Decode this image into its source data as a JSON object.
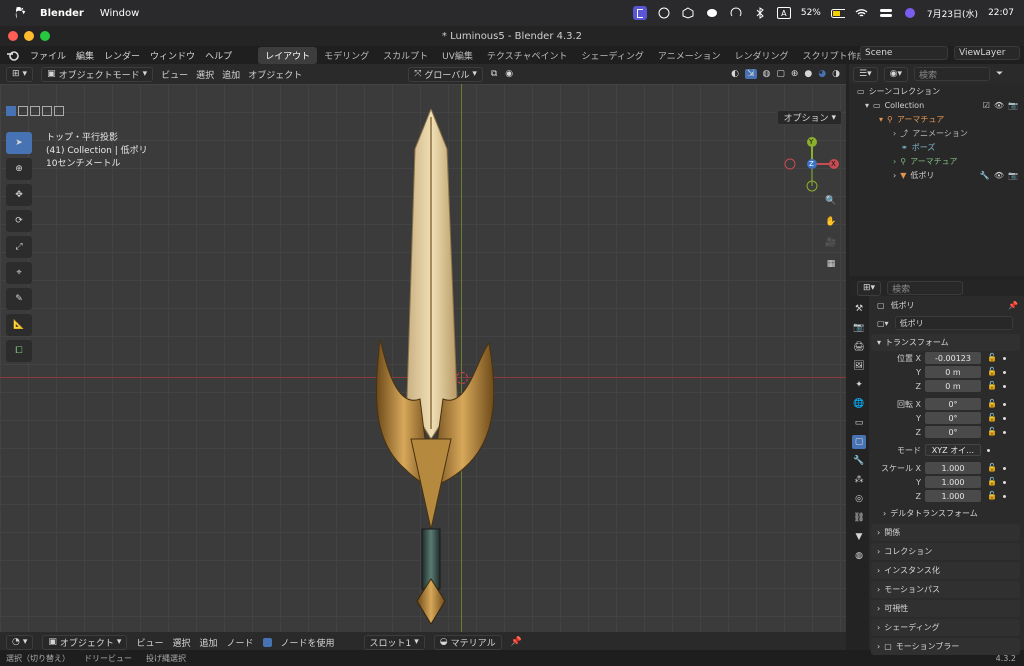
{
  "macbar": {
    "app": "Blender",
    "menu": "Window",
    "battery": "52%",
    "input": "A",
    "datetime": "7月23日(水)",
    "time": "22:07"
  },
  "window": {
    "title": "* Luminous5 - Blender 4.3.2"
  },
  "menubar": {
    "items": [
      "ファイル",
      "編集",
      "レンダー",
      "ウィンドウ",
      "ヘルプ"
    ],
    "workspaces": [
      "レイアウト",
      "モデリング",
      "スカルプト",
      "UV編集",
      "テクスチャペイント",
      "シェーディング",
      "アニメーション",
      "レンダリング",
      "スクリプト作成"
    ],
    "active_workspace": "レイアウト",
    "scene": "Scene",
    "view_layer": "ViewLayer",
    "add_tab": "+"
  },
  "viewport_header": {
    "mode": "オブジェクトモード",
    "menus": [
      "ビュー",
      "選択",
      "追加",
      "オブジェクト"
    ],
    "orientation": "グローバル",
    "options": "オプション"
  },
  "viewport_info": {
    "line1": "トップ・平行投影",
    "line2": "(41) Collection | 低ポリ",
    "line3": "10センチメートル"
  },
  "gizmo": {
    "x": "X",
    "y": "Y",
    "z": "Z"
  },
  "footer": {
    "mode": "オブジェクト",
    "menus": [
      "ビュー",
      "選択",
      "追加",
      "ノード"
    ],
    "use_nodes": "ノードを使用",
    "slot": "スロット1",
    "material": "マテリアル"
  },
  "status": {
    "items": [
      "選択（切り替え）",
      "ドリービュー",
      "投げ縄選択"
    ],
    "version": "4.3.2"
  },
  "outliner": {
    "search_placeholder": "検索",
    "rows": [
      {
        "label": "シーンコレクション",
        "indent": 0
      },
      {
        "label": "Collection",
        "indent": 1
      },
      {
        "label": "アーマチュア",
        "indent": 2
      },
      {
        "label": "アニメーション",
        "indent": 3
      },
      {
        "label": "ポーズ",
        "indent": 3
      },
      {
        "label": "アーマチュア",
        "indent": 3
      },
      {
        "label": "低ポリ",
        "indent": 3
      }
    ]
  },
  "properties": {
    "search_placeholder": "検索",
    "object_name": "低ポリ",
    "object_field": "低ポリ",
    "section_transform": "トランスフォーム",
    "location": {
      "label": "位置",
      "x": "-0.00123",
      "y": "0 m",
      "z": "0 m"
    },
    "rotation": {
      "label": "回転",
      "x": "0°",
      "y": "0°",
      "z": "0°"
    },
    "mode": {
      "label": "モード",
      "value": "XYZ オイ…"
    },
    "scale": {
      "label": "スケール",
      "x": "1.000",
      "y": "1.000",
      "z": "1.000"
    },
    "axis_labels": {
      "x": "X",
      "y": "Y",
      "z": "Z"
    },
    "delta": "デルタトランスフォーム",
    "sections": [
      "関係",
      "コレクション",
      "インスタンス化",
      "モーションパス",
      "可視性",
      "シェーディング",
      "モーションブラー"
    ]
  },
  "colors": {
    "accent": "#4772b3",
    "x_axis": "#c64b52",
    "y_axis": "#8bb02b",
    "z_axis": "#3b72c4",
    "grid": "#3b3b3b"
  }
}
